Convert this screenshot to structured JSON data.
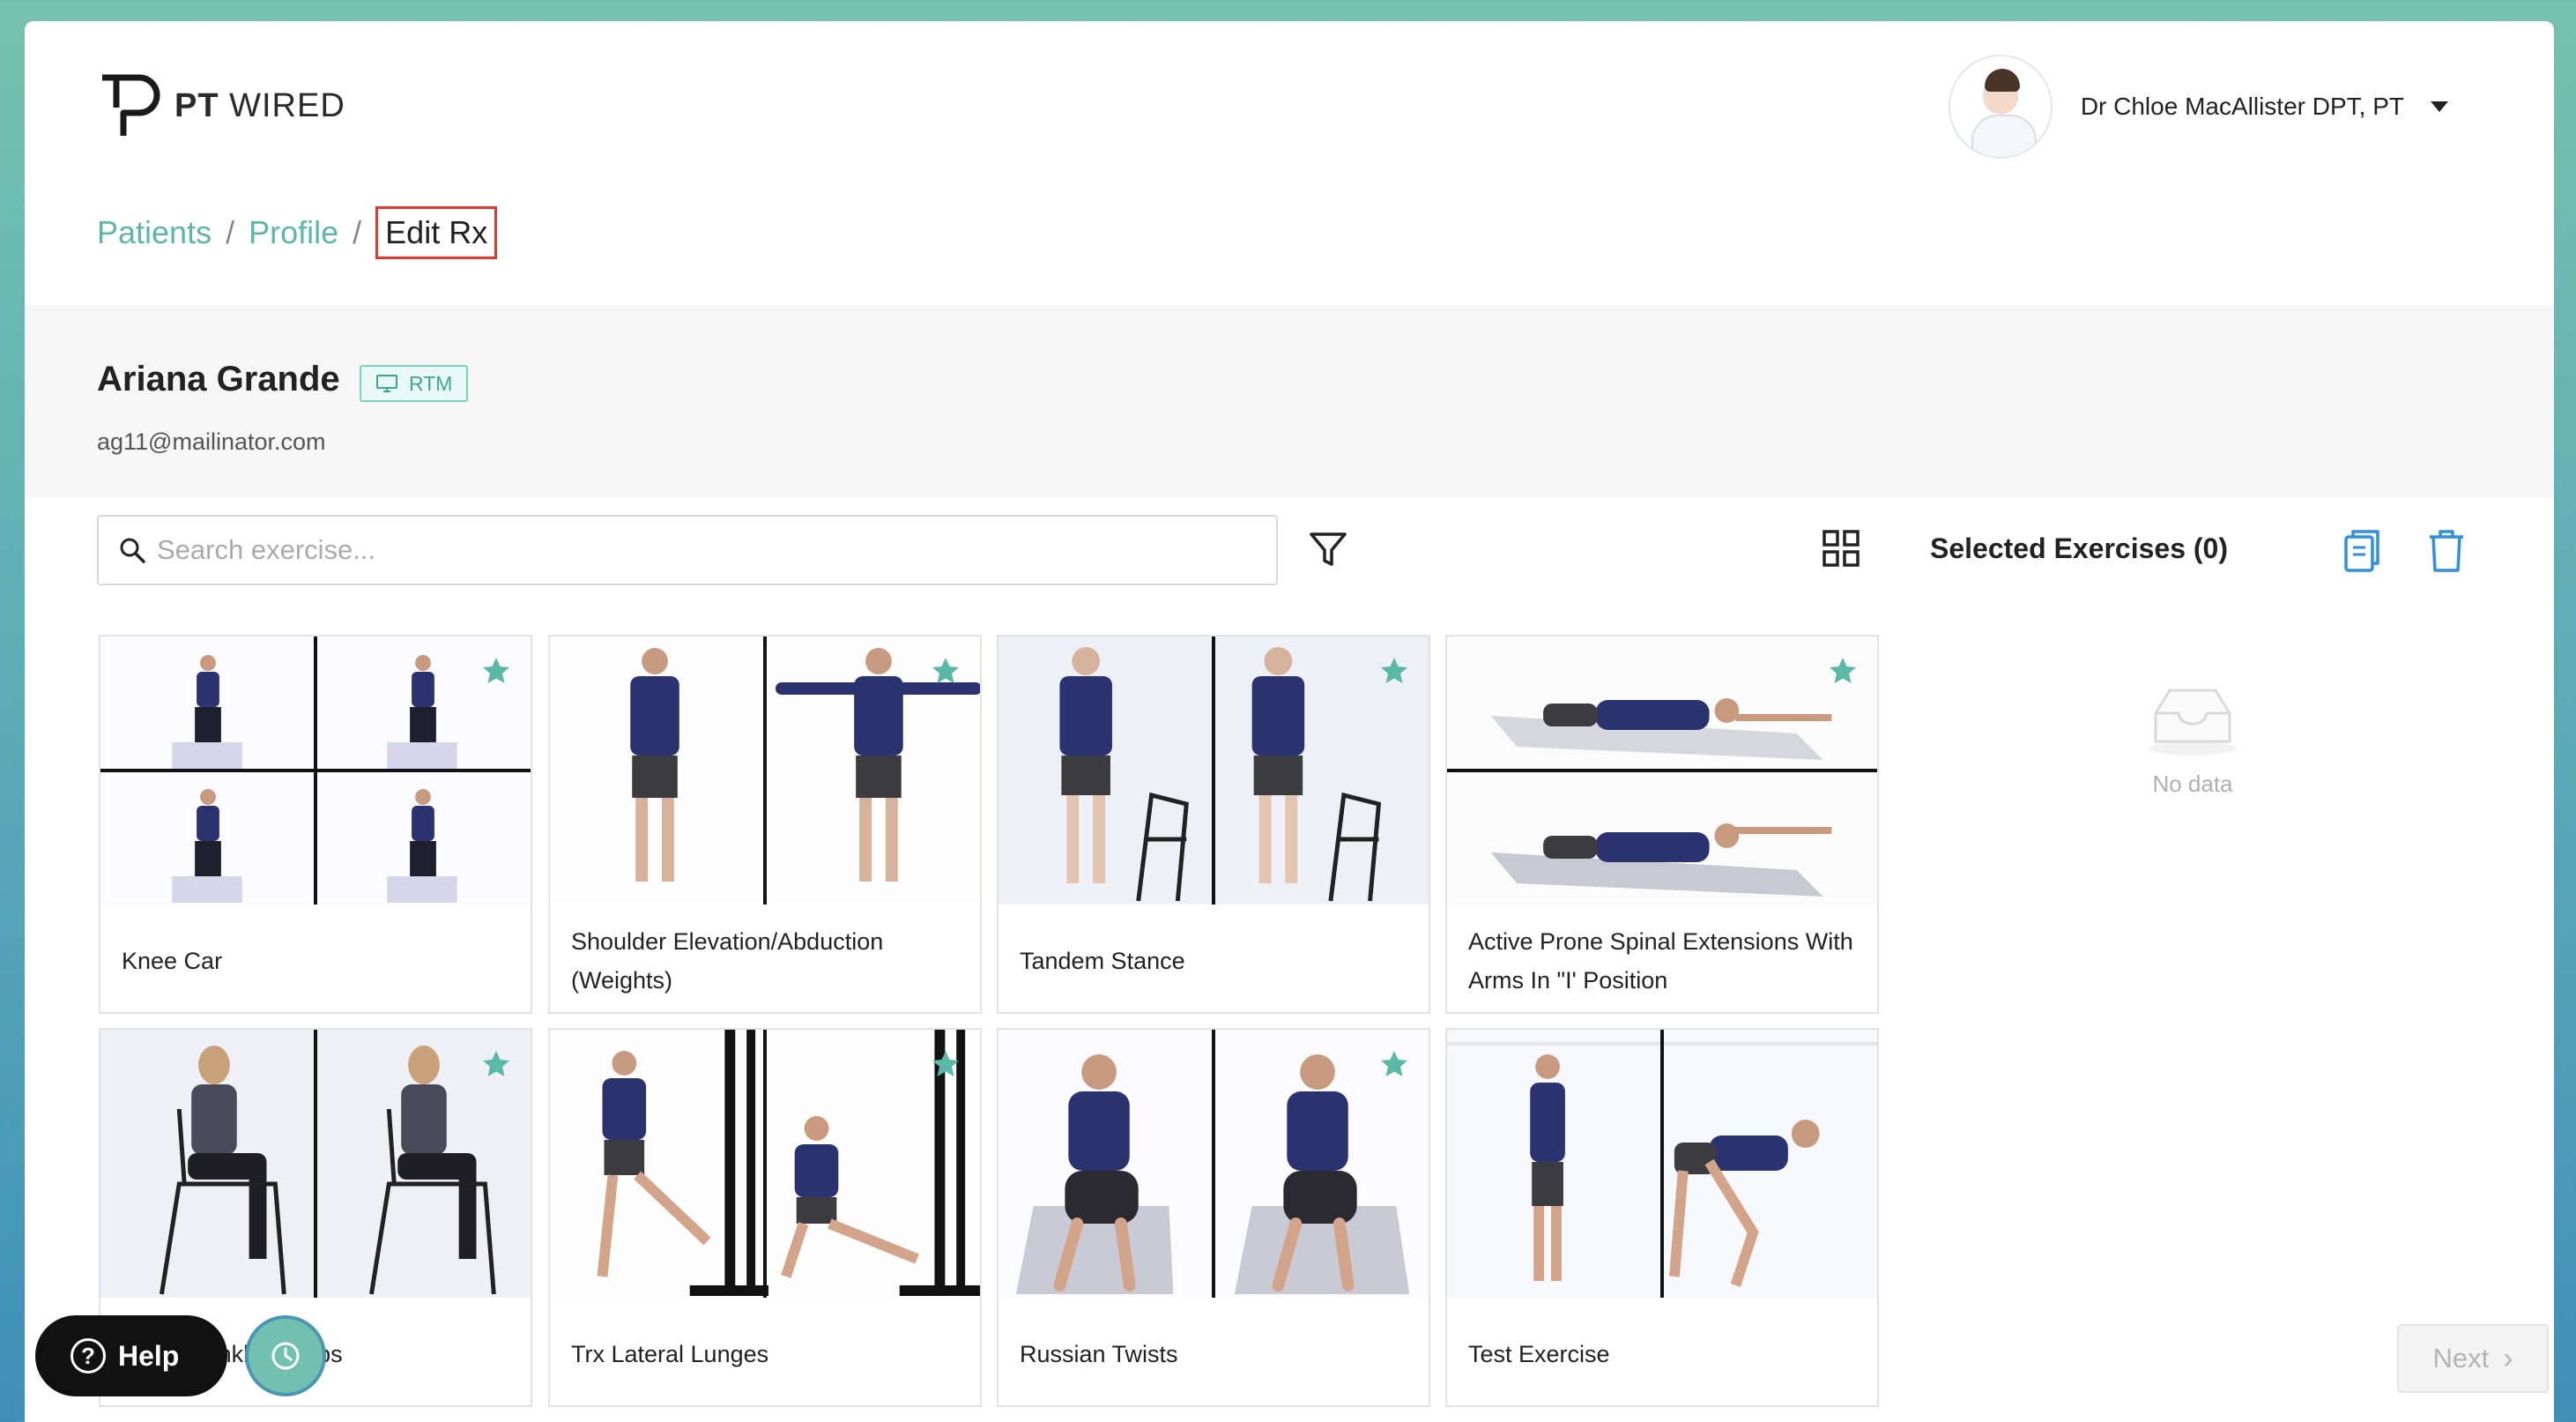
{
  "header": {
    "logo_bold": "PT",
    "logo_light": "WIRED",
    "user_name": "Dr Chloe MacAllister DPT, PT"
  },
  "breadcrumb": {
    "patients": "Patients",
    "profile": "Profile",
    "current": "Edit Rx",
    "separator": "/"
  },
  "patient": {
    "name": "Ariana Grande",
    "badge": "RTM",
    "email": "ag11@mailinator.com"
  },
  "search": {
    "placeholder": "Search exercise..."
  },
  "selected": {
    "title": "Selected Exercises (0)",
    "empty_text": "No data"
  },
  "exercises": [
    {
      "label": "Knee Car",
      "favorite": true
    },
    {
      "label": "Shoulder Elevation/Abduction (Weights)",
      "favorite": true
    },
    {
      "label": "Tandem Stance",
      "favorite": true
    },
    {
      "label": "Active Prone Spinal Extensions With Arms In \"I' Position",
      "favorite": true
    },
    {
      "label": "Seated Ankle Pumps",
      "favorite": true
    },
    {
      "label": "Trx Lateral Lunges",
      "favorite": true
    },
    {
      "label": "Russian Twists",
      "favorite": true
    },
    {
      "label": "Test Exercise",
      "favorite": false
    }
  ],
  "help": {
    "label": "Help"
  },
  "next": {
    "label": "Next"
  },
  "colors": {
    "accent": "#5ab8a6",
    "highlight_border": "#e03a2e",
    "icon_blue": "#2f8fe0"
  }
}
